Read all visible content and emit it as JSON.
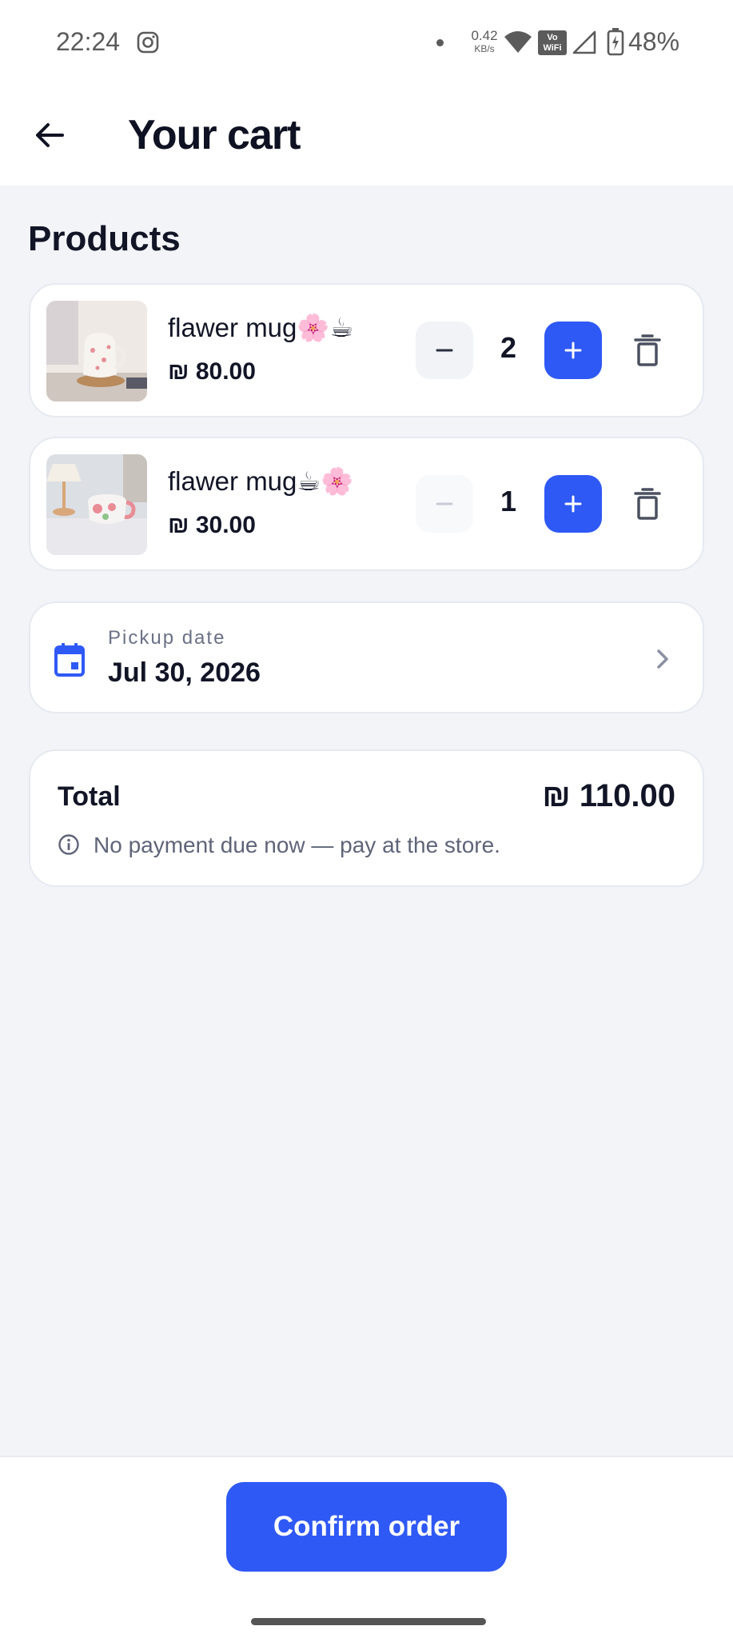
{
  "status_bar": {
    "time": "22:24",
    "net_speed_value": "0.42",
    "net_speed_unit": "KB/s",
    "vowifi_line1": "Vo",
    "vowifi_line2": "WiFi",
    "battery_percent": "48%",
    "icons": [
      "instagram-icon",
      "wifi-icon",
      "vowifi-icon",
      "signal-icon",
      "battery-charging-icon"
    ]
  },
  "header": {
    "title": "Your cart"
  },
  "products": {
    "section_title": "Products",
    "items": [
      {
        "name": "flawer mug🌸☕",
        "price": "₪ 80.00",
        "quantity": "2",
        "decrement_enabled": true
      },
      {
        "name": "flawer mug☕🌸",
        "price": "₪ 30.00",
        "quantity": "1",
        "decrement_enabled": false
      }
    ]
  },
  "pickup": {
    "label": "Pickup date",
    "date": "Jul 30, 2026"
  },
  "total": {
    "label": "Total",
    "value": "₪ 110.00",
    "note": "No payment due now — pay at the store."
  },
  "footer": {
    "confirm_label": "Confirm order"
  },
  "colors": {
    "primary": "#2f59f5",
    "background": "#f2f4f8",
    "card": "#ffffff",
    "text": "#121526",
    "muted": "#6b7186"
  }
}
